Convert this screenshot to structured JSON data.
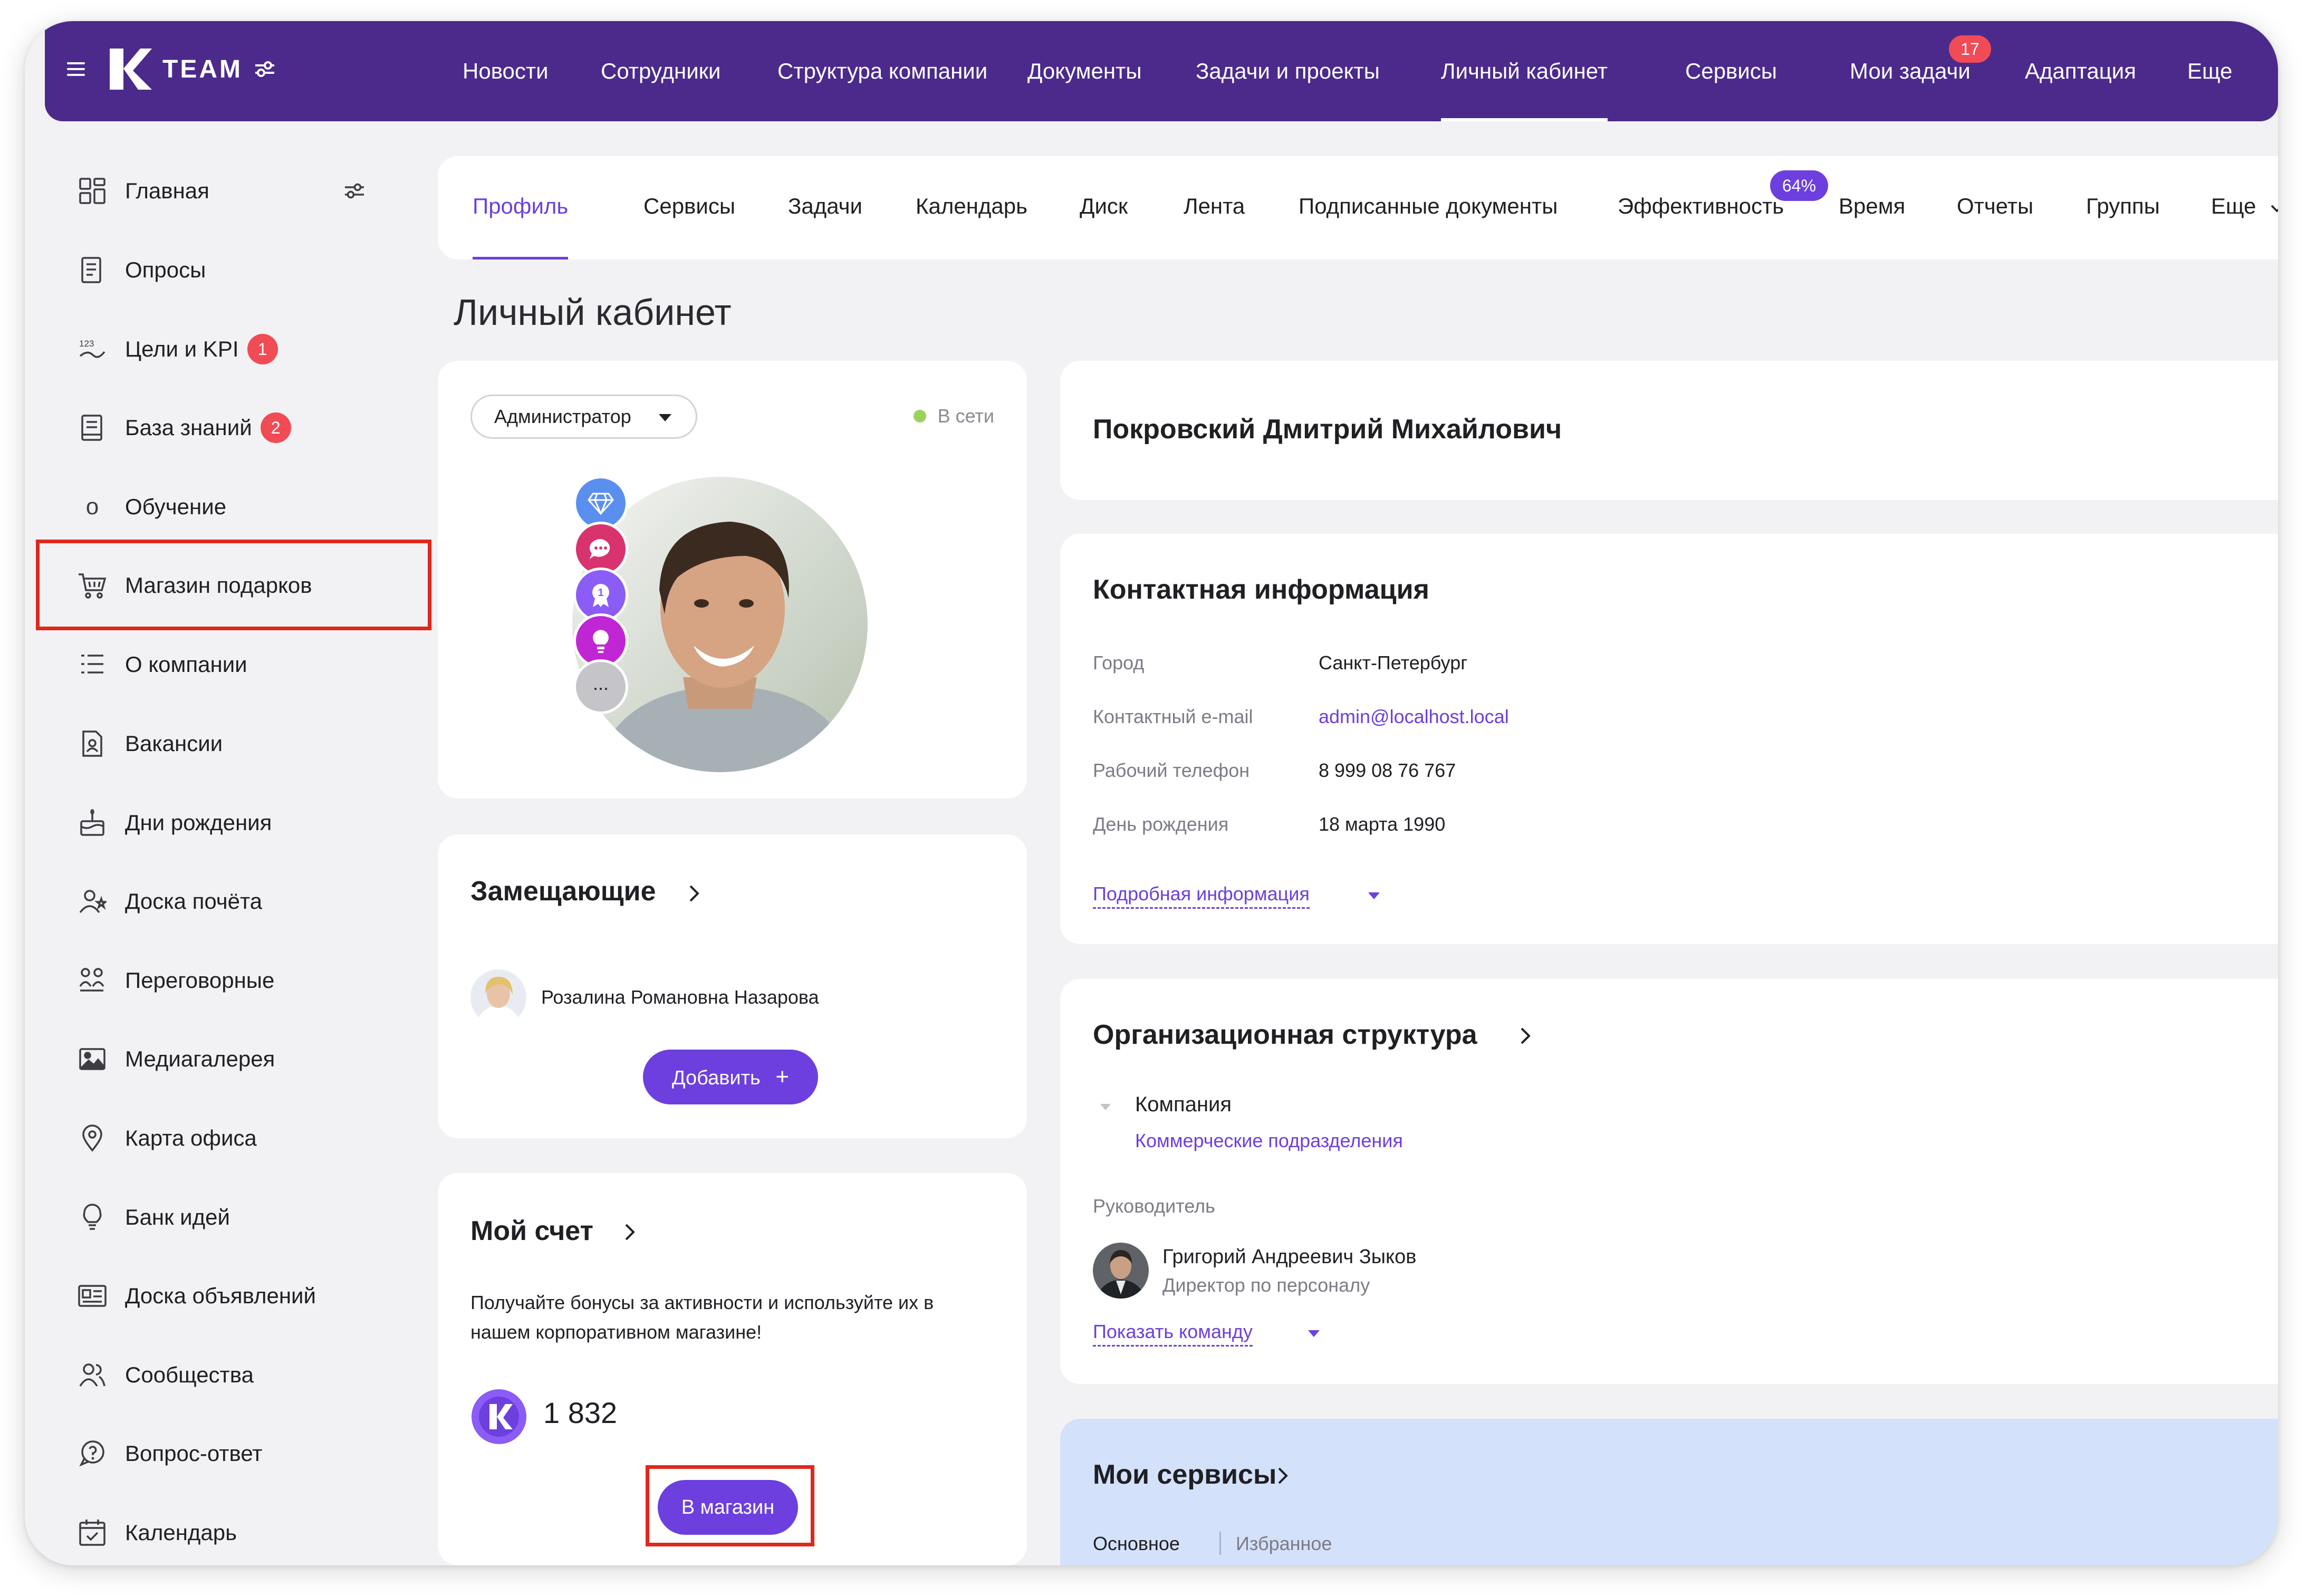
{
  "header": {
    "logo_text": "TEAM",
    "nav": [
      {
        "label": "Новости"
      },
      {
        "label": "Сотрудники"
      },
      {
        "label": "Структура компании"
      },
      {
        "label": "Документы"
      },
      {
        "label": "Задачи и проекты"
      },
      {
        "label": "Личный кабинет"
      },
      {
        "label": "Сервисы"
      },
      {
        "label": "Мои задачи",
        "badge": "17"
      },
      {
        "label": "Адаптация"
      },
      {
        "label": "Еще"
      }
    ]
  },
  "sidebar": {
    "items": [
      {
        "label": "Главная",
        "icon": "dashboard-icon"
      },
      {
        "label": "Опросы",
        "icon": "survey-icon"
      },
      {
        "label": "Цели и KPI",
        "icon": "kpi-icon",
        "badge": "1"
      },
      {
        "label": "База знаний",
        "icon": "knowledge-base-icon",
        "badge": "2"
      },
      {
        "label": "Обучение",
        "icon": "learning-icon",
        "icon_glyph": "o"
      },
      {
        "label": "Магазин подарков",
        "icon": "cart-icon"
      },
      {
        "label": "О компании",
        "icon": "company-list-icon"
      },
      {
        "label": "Вакансии",
        "icon": "vacancy-icon"
      },
      {
        "label": "Дни рождения",
        "icon": "cake-icon"
      },
      {
        "label": "Доска почёта",
        "icon": "honor-board-icon"
      },
      {
        "label": "Переговорные",
        "icon": "meeting-rooms-icon"
      },
      {
        "label": "Медиагалерея",
        "icon": "gallery-icon"
      },
      {
        "label": "Карта офиса",
        "icon": "map-pin-icon"
      },
      {
        "label": "Банк идей",
        "icon": "lightbulb-icon"
      },
      {
        "label": "Доска объявлений",
        "icon": "announcement-board-icon"
      },
      {
        "label": "Сообщества",
        "icon": "communities-icon"
      },
      {
        "label": "Вопрос-ответ",
        "icon": "faq-icon"
      },
      {
        "label": "Календарь",
        "icon": "calendar-icon"
      }
    ]
  },
  "tabs": {
    "items": [
      {
        "label": "Профиль"
      },
      {
        "label": "Сервисы"
      },
      {
        "label": "Задачи"
      },
      {
        "label": "Календарь"
      },
      {
        "label": "Диск"
      },
      {
        "label": "Лента"
      },
      {
        "label": "Подписанные документы"
      },
      {
        "label": "Эффективность",
        "badge": "64%"
      },
      {
        "label": "Время"
      },
      {
        "label": "Отчеты"
      },
      {
        "label": "Группы"
      },
      {
        "label": "Еще"
      }
    ]
  },
  "page": {
    "title": "Личный кабинет"
  },
  "profile": {
    "role": "Администратор",
    "status": "В сети",
    "achievement_more": "...",
    "name": "Покровский Дмитрий Михайлович"
  },
  "deputies": {
    "title": "Замещающие",
    "person": "Розалина Романовна Назарова",
    "add_button": "Добавить"
  },
  "account": {
    "title": "Мой счет",
    "description": "Получайте бонусы за активности и используйте их в нашем корпоративном магазине!",
    "balance": "1 832",
    "store_button": "В магазин"
  },
  "contacts": {
    "title": "Контактная информация",
    "rows": [
      {
        "key": "Город",
        "value": "Санкт-Петербург"
      },
      {
        "key": "Контактный e-mail",
        "value": "admin@localhost.local"
      },
      {
        "key": "Рабочий телефон",
        "value": "8 999 08 76 767"
      },
      {
        "key": "День рождения",
        "value": "18 марта 1990"
      }
    ],
    "more_link": "Подробная информация"
  },
  "org": {
    "title": "Организационная структура",
    "company": "Компания",
    "department": "Коммерческие подразделения",
    "manager_label": "Руководитель",
    "manager_name": "Григорий Андреевич Зыков",
    "manager_position": "Директор по персоналу",
    "team_link": "Показать команду"
  },
  "services": {
    "title": "Мои сервисы",
    "tabs": [
      "Основное",
      "Избранное"
    ]
  },
  "colors": {
    "brand": "#4b2a8c",
    "accent": "#6d3fde",
    "badge": "#f14b56",
    "highlight": "#e0271b",
    "online": "#9bd35a",
    "services_bg": "#d4e1fb"
  }
}
